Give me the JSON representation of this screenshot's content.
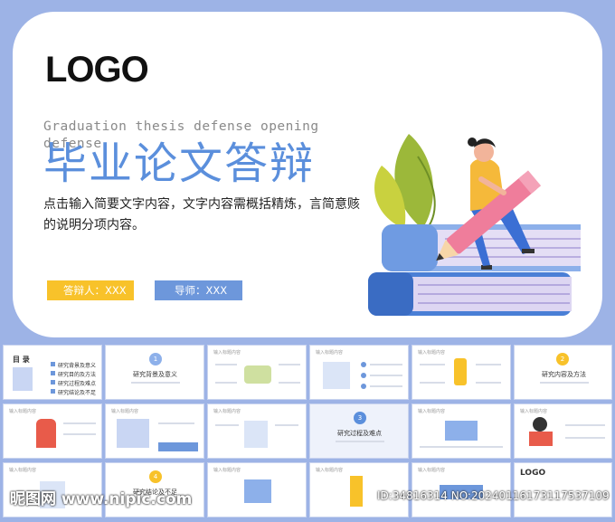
{
  "hero": {
    "logo": "LOGO",
    "subtitle_en": "Graduation thesis defense opening defense",
    "title_cn": "毕业论文答辩",
    "description": "点击输入简要文字内容，文字内容需概括精炼，言简意赅的说明分项内容。",
    "defender_label": "答辩人：XXX",
    "advisor_label": "导师：XXX"
  },
  "thumbnails": [
    {
      "title": "目 录",
      "items": [
        "研究背景及意义",
        "研究目的及方法",
        "研究过程及难点",
        "研究结论及不足"
      ]
    },
    {
      "number": "1",
      "title": "研究背景及意义"
    },
    {
      "title": "输入标题内容"
    },
    {
      "title": "输入标题内容"
    },
    {
      "title": "输入标题内容"
    },
    {
      "number": "2",
      "title": "研究内容及方法"
    },
    {
      "title": "输入标题内容"
    },
    {
      "title": "输入标题内容"
    },
    {
      "title": "输入标题内容"
    },
    {
      "number": "3",
      "title": "研究过程及难点"
    },
    {
      "title": "输入标题内容"
    },
    {
      "title": "输入标题内容"
    },
    {
      "title": "输入标题内容"
    },
    {
      "number": "4",
      "title": "研究结论及不足"
    },
    {
      "title": "输入标题内容"
    },
    {
      "title": "输入标题内容"
    },
    {
      "title": "输入标题内容"
    },
    {
      "title": "LOGO"
    }
  ],
  "watermark": {
    "site": "昵图网 www.nipic.com",
    "id_text": "ID:34816314 NO:20240116173117537109"
  },
  "colors": {
    "background": "#9db3e6",
    "accent_blue": "#5b8fdc",
    "accent_yellow": "#f8c22a",
    "button_blue": "#6d97db"
  }
}
